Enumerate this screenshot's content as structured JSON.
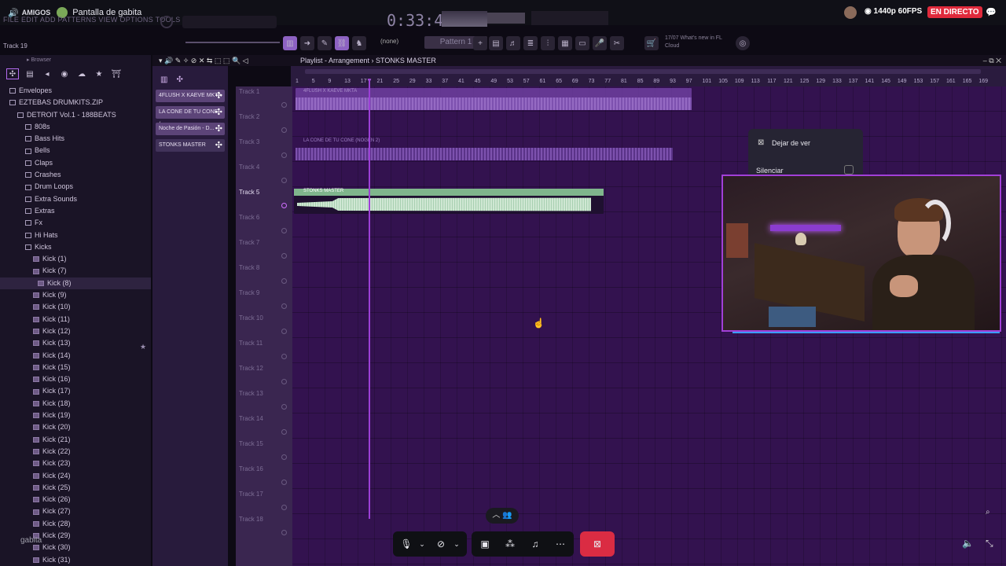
{
  "stream": {
    "group": "AMIGOS",
    "screen_title": "Pantalla de gabita",
    "quality": "1440p 60FPS",
    "live_label": "EN DIRECTO",
    "user": "gabita"
  },
  "fl": {
    "menu": "FILE EDIT ADD PATTERNS VIEW OPTIONS TOOLS HELP",
    "time": "0:33:44",
    "track_label": "Track 19",
    "pattern": "Pattern 1",
    "none_select": "(none)",
    "news_date": "17/07",
    "news_text": "What's new in FL",
    "news_sub": "Cloud",
    "playlist_title": "Playlist - Arrangement › STONKS MASTER",
    "browser_label": "Browser"
  },
  "browser": {
    "items": [
      {
        "label": "Envelopes",
        "level": 0
      },
      {
        "label": "EZTEBAS DRUMKITS.ZIP",
        "level": 0
      },
      {
        "label": "DETROIT Vol.1 - 188BEATS",
        "level": 1
      },
      {
        "label": "808s",
        "level": 2
      },
      {
        "label": "Bass Hits",
        "level": 2
      },
      {
        "label": "Bells",
        "level": 2
      },
      {
        "label": "Claps",
        "level": 2
      },
      {
        "label": "Crashes",
        "level": 2
      },
      {
        "label": "Drum Loops",
        "level": 2
      },
      {
        "label": "Extra Sounds",
        "level": 2
      },
      {
        "label": "Extras",
        "level": 2
      },
      {
        "label": "Fx",
        "level": 2
      },
      {
        "label": "Hi Hats",
        "level": 2
      },
      {
        "label": "Kicks",
        "level": 2
      },
      {
        "label": "Kick (1)",
        "level": 3
      },
      {
        "label": "Kick (7)",
        "level": 3
      },
      {
        "label": "Kick (8)",
        "level": 3,
        "selected": true
      },
      {
        "label": "Kick (9)",
        "level": 3
      },
      {
        "label": "Kick (10)",
        "level": 3
      },
      {
        "label": "Kick (11)",
        "level": 3
      },
      {
        "label": "Kick (12)",
        "level": 3
      },
      {
        "label": "Kick (13)",
        "level": 3
      },
      {
        "label": "Kick (14)",
        "level": 3
      },
      {
        "label": "Kick (15)",
        "level": 3
      },
      {
        "label": "Kick (16)",
        "level": 3
      },
      {
        "label": "Kick (17)",
        "level": 3
      },
      {
        "label": "Kick (18)",
        "level": 3
      },
      {
        "label": "Kick (19)",
        "level": 3
      },
      {
        "label": "Kick (20)",
        "level": 3
      },
      {
        "label": "Kick (21)",
        "level": 3
      },
      {
        "label": "Kick (22)",
        "level": 3
      },
      {
        "label": "Kick (23)",
        "level": 3
      },
      {
        "label": "Kick (24)",
        "level": 3
      },
      {
        "label": "Kick (25)",
        "level": 3
      },
      {
        "label": "Kick (26)",
        "level": 3
      },
      {
        "label": "Kick (27)",
        "level": 3
      },
      {
        "label": "Kick (28)",
        "level": 3
      },
      {
        "label": "Kick (29)",
        "level": 3
      },
      {
        "label": "Kick (30)",
        "level": 3
      },
      {
        "label": "Kick (31)",
        "level": 3
      }
    ]
  },
  "channels": [
    "4FLUSH X KAEVE MKTA",
    "LA CONE DE TU CONE (...",
    "Noche de Pasión - D...",
    "STONKS MASTER"
  ],
  "ruler": [
    "1",
    "5",
    "9",
    "13",
    "17",
    "21",
    "25",
    "29",
    "33",
    "37",
    "41",
    "45",
    "49",
    "53",
    "57",
    "61",
    "65",
    "69",
    "73",
    "77",
    "81",
    "85",
    "89",
    "93",
    "97",
    "101",
    "105",
    "109",
    "113",
    "117",
    "121",
    "125",
    "129",
    "133",
    "137",
    "141",
    "145",
    "149",
    "153",
    "157",
    "161",
    "165",
    "169"
  ],
  "tracks": [
    "Track 1",
    "Track 2",
    "Track 3",
    "Track 4",
    "Track 5",
    "Track 6",
    "Track 7",
    "Track 8",
    "Track 9",
    "Track 10",
    "Track 11",
    "Track 12",
    "Track 13",
    "Track 14",
    "Track 15",
    "Track 16",
    "Track 17",
    "Track 18"
  ],
  "clips": {
    "c1": "4FLUSH X KAEVE MKTA",
    "c2": "LA CONE DE TU CONE (NOGEN 2)",
    "c3": "STONKS MASTER"
  },
  "popup": {
    "stop_watching": "Dejar de ver",
    "mute": "Silenciar"
  }
}
